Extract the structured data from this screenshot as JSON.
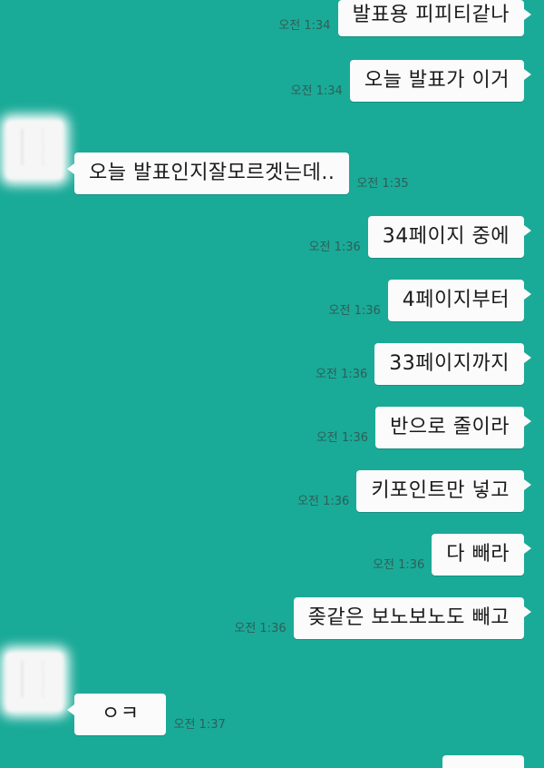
{
  "colors": {
    "background": "#1aaa98",
    "bubble": "#fbfbfb",
    "timestamp": "#2f5e57"
  },
  "messages": [
    {
      "side": "right",
      "text": "발표용 피피티같나",
      "time": "오전 1:34"
    },
    {
      "side": "right",
      "text": "오늘 발표가 이거",
      "time": "오전 1:34"
    },
    {
      "side": "left",
      "text": "오늘 발표인지잘모르겟는데..",
      "time": "오전 1:35"
    },
    {
      "side": "right",
      "text": "34페이지 중에",
      "time": "오전 1:36"
    },
    {
      "side": "right",
      "text": "4페이지부터",
      "time": "오전 1:36"
    },
    {
      "side": "right",
      "text": "33페이지까지",
      "time": "오전 1:36"
    },
    {
      "side": "right",
      "text": "반으로 줄이라",
      "time": "오전 1:36"
    },
    {
      "side": "right",
      "text": "키포인트만 넣고",
      "time": "오전 1:36"
    },
    {
      "side": "right",
      "text": "다 빼라",
      "time": "오전 1:36"
    },
    {
      "side": "right",
      "text": "좆같은 보노보노도 빼고",
      "time": "오전 1:36"
    },
    {
      "side": "left",
      "text": "ㅇㅋ",
      "time": "오전 1:37"
    }
  ]
}
